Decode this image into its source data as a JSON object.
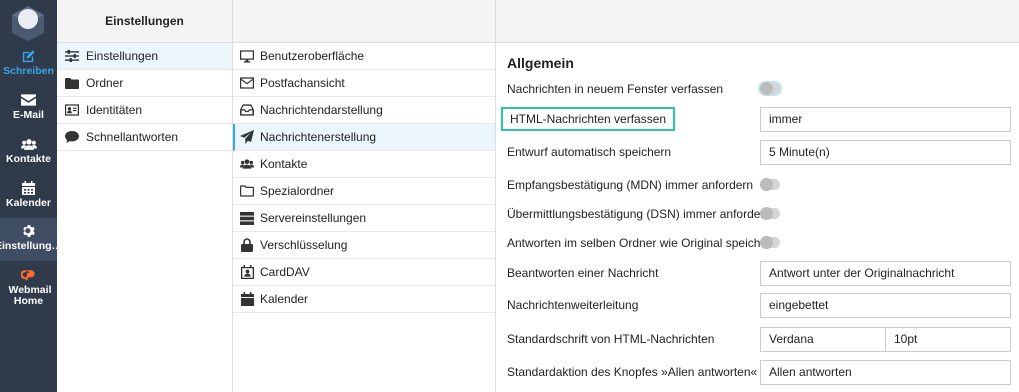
{
  "nav": {
    "items": [
      {
        "label": "Schreiben",
        "icon": "compose-icon"
      },
      {
        "label": "E-Mail",
        "icon": "envelope-icon"
      },
      {
        "label": "Kontakte",
        "icon": "users-icon"
      },
      {
        "label": "Kalender",
        "icon": "calendar-icon"
      },
      {
        "label": "Einstellung…",
        "icon": "gear-icon"
      },
      {
        "label": "Webmail Home",
        "icon": "cpanel-icon"
      }
    ]
  },
  "col1": {
    "title": "Einstellungen",
    "items": [
      {
        "label": "Einstellungen",
        "icon": "sliders-icon"
      },
      {
        "label": "Ordner",
        "icon": "folder-icon"
      },
      {
        "label": "Identitäten",
        "icon": "id-card-icon"
      },
      {
        "label": "Schnellantworten",
        "icon": "comment-icon"
      }
    ]
  },
  "col2": {
    "items": [
      {
        "label": "Benutzeroberfläche",
        "icon": "monitor-icon"
      },
      {
        "label": "Postfachansicht",
        "icon": "mailbox-view-icon"
      },
      {
        "label": "Nachrichtendarstellung",
        "icon": "inbox-icon"
      },
      {
        "label": "Nachrichtenerstellung",
        "icon": "paper-plane-icon"
      },
      {
        "label": "Kontakte",
        "icon": "users-icon"
      },
      {
        "label": "Spezialordner",
        "icon": "folder-outline-icon"
      },
      {
        "label": "Servereinstellungen",
        "icon": "server-icon"
      },
      {
        "label": "Verschlüsselung",
        "icon": "lock-icon"
      },
      {
        "label": "CardDAV",
        "icon": "address-card-icon"
      },
      {
        "label": "Kalender",
        "icon": "calendar-icon"
      }
    ]
  },
  "main": {
    "section_title": "Allgemein",
    "rows": [
      {
        "label": "Nachrichten in neuem Fenster verfassen",
        "type": "toggle"
      },
      {
        "label": "HTML-Nachrichten verfassen",
        "type": "select",
        "value": "immer"
      },
      {
        "label": "Entwurf automatisch speichern",
        "type": "select",
        "value": "5 Minute(n)"
      },
      {
        "label": "Empfangsbestätigung (MDN) immer anfordern",
        "type": "toggle"
      },
      {
        "label": "Übermittlungsbestätigung (DSN) immer anfordern",
        "type": "toggle"
      },
      {
        "label": "Antworten im selben Ordner wie Original speichern",
        "type": "toggle"
      },
      {
        "label": "Beantworten einer Nachricht",
        "type": "select",
        "value": "Antwort unter der Originalnachricht"
      },
      {
        "label": "Nachrichtenweiterleitung",
        "type": "select",
        "value": "eingebettet"
      },
      {
        "label": "Standardschrift von HTML-Nachrichten",
        "type": "font",
        "value": "Verdana",
        "value2": "10pt"
      },
      {
        "label": "Standardaktion des Knopfes »Allen antworten«",
        "type": "select",
        "value": "Allen antworten"
      }
    ]
  },
  "colors": {
    "nav_bg": "#2f3a4a",
    "accent": "#37a8e6",
    "highlight": "#2ec4a6",
    "cpanel": "#ff6c2c"
  }
}
